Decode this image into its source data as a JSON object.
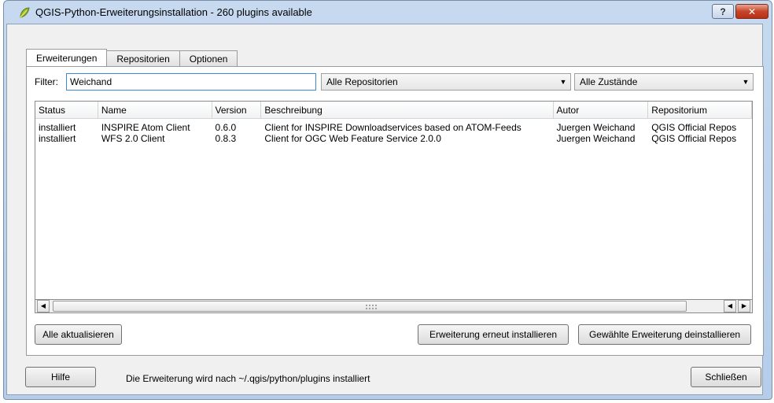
{
  "window": {
    "title": "QGIS-Python-Erweiterungsinstallation - 260 plugins available",
    "help_symbol": "?",
    "close_symbol": "✕"
  },
  "tabs": [
    {
      "label": "Erweiterungen",
      "active": true
    },
    {
      "label": "Repositorien",
      "active": false
    },
    {
      "label": "Optionen",
      "active": false
    }
  ],
  "filter": {
    "label": "Filter:",
    "value": "Weichand",
    "repository": "Alle Repositorien",
    "state": "Alle Zustände"
  },
  "table": {
    "columns": [
      "Status",
      "Name",
      "Version",
      "Beschreibung",
      "Autor",
      "Repositorium"
    ],
    "rows": [
      [
        "installiert",
        "INSPIRE Atom Client",
        "0.6.0",
        "Client for INSPIRE Downloadservices based on ATOM-Feeds",
        "Juergen Weichand",
        "QGIS Official Repos"
      ],
      [
        "installiert",
        "WFS 2.0 Client",
        "0.8.3",
        "Client for OGC Web Feature Service 2.0.0",
        "Juergen Weichand",
        "QGIS Official Repos"
      ]
    ]
  },
  "scrollbar": {
    "left_arrow": "◀",
    "right_arrow": "▶"
  },
  "buttons": {
    "update_all": "Alle aktualisieren",
    "reinstall": "Erweiterung erneut installieren",
    "uninstall": "Gewählte Erweiterung deinstallieren",
    "help": "Hilfe",
    "close": "Schließen"
  },
  "status_message": "Die Erweiterung wird nach ~/.qgis/python/plugins installiert",
  "icons": {
    "app": "qgis-leaf-icon",
    "dropdown": "▼"
  }
}
